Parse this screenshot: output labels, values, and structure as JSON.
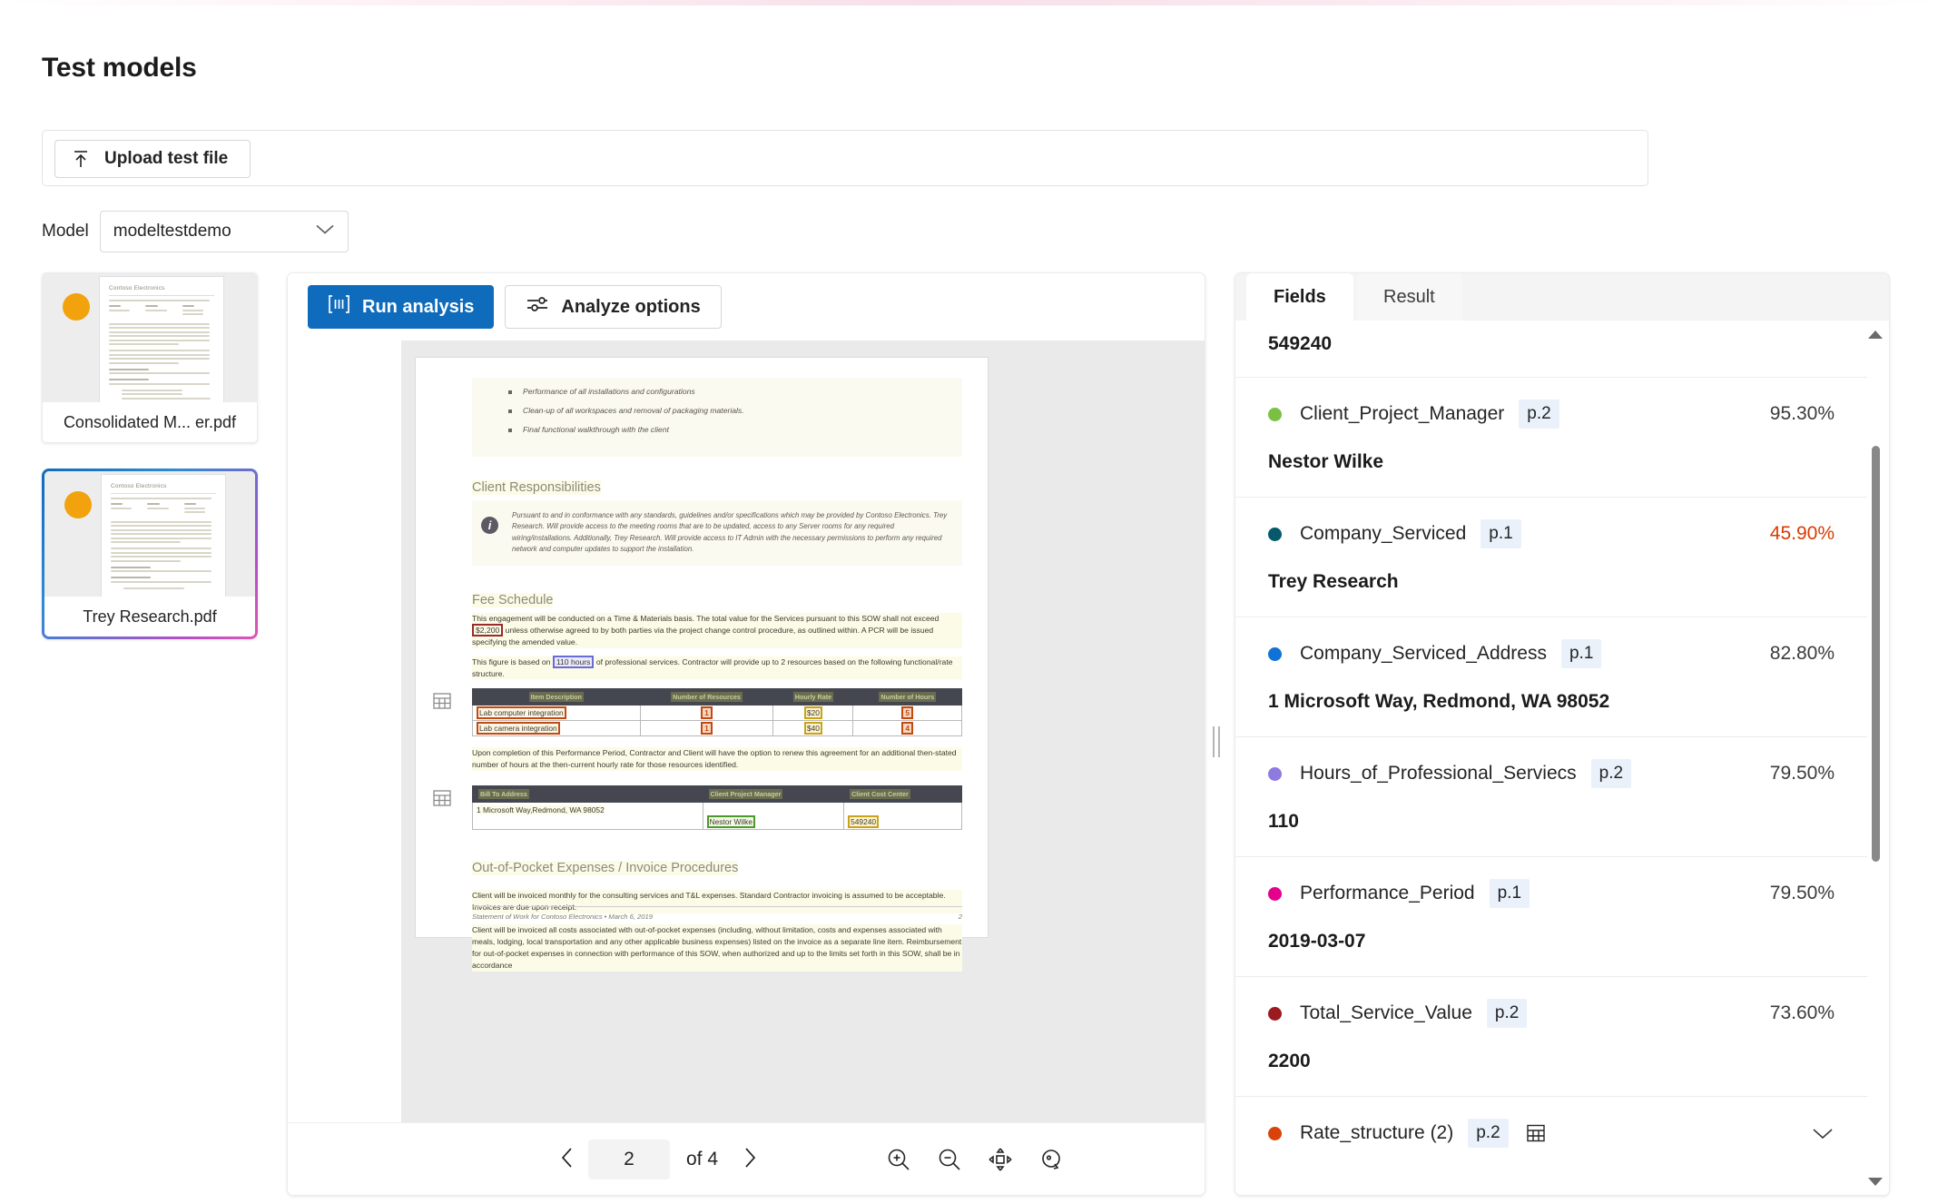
{
  "page": {
    "title": "Test models"
  },
  "upload": {
    "button_label": "Upload test file",
    "icon": "upload-arrow-icon"
  },
  "model": {
    "label": "Model",
    "selected": "modeltestdemo",
    "chevron_icon": "chevron-down-icon"
  },
  "thumbnails": [
    {
      "label": "Consolidated M... er.pdf",
      "selected": false,
      "dot_color": "#f2a20c",
      "doc_heading": "Contoso Electronics"
    },
    {
      "label": "Trey Research.pdf",
      "selected": true,
      "dot_color": "#f2a20c",
      "doc_heading": "Contoso Electronics"
    }
  ],
  "viewer": {
    "run_analysis_label": "Run analysis",
    "run_analysis_icon": "analyze-scan-icon",
    "analyze_options_label": "Analyze options",
    "analyze_options_icon": "sliders-icon",
    "pager": {
      "prev_icon": "chevron-left-icon",
      "next_icon": "chevron-right-icon",
      "current_page": "2",
      "of_label": "of 4"
    },
    "zoom_tools": [
      {
        "icon": "zoom-in-icon"
      },
      {
        "icon": "zoom-out-icon"
      },
      {
        "icon": "fit-to-page-icon"
      },
      {
        "icon": "rotate-icon"
      }
    ]
  },
  "document": {
    "bullets": [
      "Performance of all installations and configurations",
      "Clean-up of all workspaces and removal of packaging materials.",
      "Final functional walkthrough with the client"
    ],
    "client_responsibilities_heading": "Client Responsibilities",
    "client_responsibilities_text": "Pursuant to and in conformance with any standards, guidelines and/or specifications which may be provided by Contoso Electronics. Trey Research. Will provide access to the meeting rooms that are to be updated, access to any Server rooms for any required wiring/installations. Additionally, Trey Research. Will provide access to IT Admin with the necessary permissions to perform any required network and computer updates to support the installation.",
    "fee_schedule_heading": "Fee Schedule",
    "fee_p1_a": "This engagement will be conducted on a Time & Materials basis. The total value for the Services pursuant to this SOW shall not exceed ",
    "fee_p1_highlight": "$2,200",
    "fee_p1_b": " unless otherwise agreed to by both parties via the project change control procedure, as outlined within. A PCR will be issued specifying the amended value.",
    "fee_p2_a": "This figure is based on ",
    "fee_p2_highlight": "110 hours",
    "fee_p2_b": " of professional services. Contractor will provide up to 2 resources based on the following functional/rate structure.",
    "rate_table": {
      "headers": [
        "Item Description",
        "Number of Resources",
        "Hourly Rate",
        "Number of Hours"
      ],
      "rows": [
        [
          "Lab computer integration",
          "1",
          "$20",
          "5"
        ],
        [
          "Lab camera integration",
          "1",
          "$40",
          "4"
        ]
      ]
    },
    "renew_text": "Upon completion of this Performance Period, Contractor and Client will have the option to renew this agreement for an additional then-stated number of hours at the then-current hourly rate for those resources identified.",
    "billing_table": {
      "headers": [
        "Bill To Address",
        "Client Project Manager",
        "Client Cost Center"
      ],
      "rows": [
        [
          "1 Microsoft Way,Redmond, WA 98052",
          "Nestor Wilke",
          "549240"
        ]
      ]
    },
    "oop_heading": "Out-of-Pocket Expenses / Invoice Procedures",
    "oop_p1": "Client will be invoiced monthly for the consulting services and T&L expenses. Standard Contractor invoicing is assumed to be acceptable. Invoices are due upon receipt.",
    "oop_p2": "Client will be invoiced all costs associated with out-of-pocket expenses (including, without limitation, costs and expenses associated with meals, lodging, local transportation and any other applicable business expenses) listed on the invoice as a separate line item. Reimbursement for out-of-pocket expenses in connection with performance of this SOW, when authorized and up to the limits set forth in this SOW, shall be in accordance",
    "footer_left": "Statement of Work for Contoso Electronics • March 6, 2019",
    "footer_right": "2"
  },
  "fields_panel": {
    "tabs": [
      {
        "label": "Fields",
        "active": true
      },
      {
        "label": "Result",
        "active": false
      }
    ],
    "partial_top_value": "549240",
    "fields": [
      {
        "name": "Client_Project_Manager",
        "page": "p.2",
        "confidence": "95.30%",
        "low": false,
        "value": "Nestor Wilke",
        "dot_color": "#7ac143"
      },
      {
        "name": "Company_Serviced",
        "page": "p.1",
        "confidence": "45.90%",
        "low": true,
        "value": "Trey Research",
        "dot_color": "#05596b"
      },
      {
        "name": "Company_Serviced_Address",
        "page": "p.1",
        "confidence": "82.80%",
        "low": false,
        "value": "1 Microsoft Way, Redmond, WA 98052",
        "dot_color": "#0f72d6"
      },
      {
        "name": "Hours_of_Professional_Serviecs",
        "page": "p.2",
        "confidence": "79.50%",
        "low": false,
        "value": "110",
        "dot_color": "#8f7ae0"
      },
      {
        "name": "Performance_Period",
        "page": "p.1",
        "confidence": "79.50%",
        "low": false,
        "value": "2019-03-07",
        "dot_color": "#e3008c"
      },
      {
        "name": "Total_Service_Value",
        "page": "p.2",
        "confidence": "73.60%",
        "low": false,
        "value": "2200",
        "dot_color": "#9b1b20"
      }
    ],
    "table_field": {
      "name": "Rate_structure (2)",
      "page": "p.2",
      "dot_color": "#d9430b",
      "table_icon": "table-icon",
      "expand_icon": "chevron-down-icon"
    },
    "scrollbar": {
      "up_icon": "scroll-up-arrow-icon",
      "down_icon": "scroll-down-arrow-icon"
    }
  },
  "colors": {
    "accent": "#0f6cbd",
    "low_confidence": "#d83b01",
    "page_badge_bg": "#eaf1fb"
  }
}
